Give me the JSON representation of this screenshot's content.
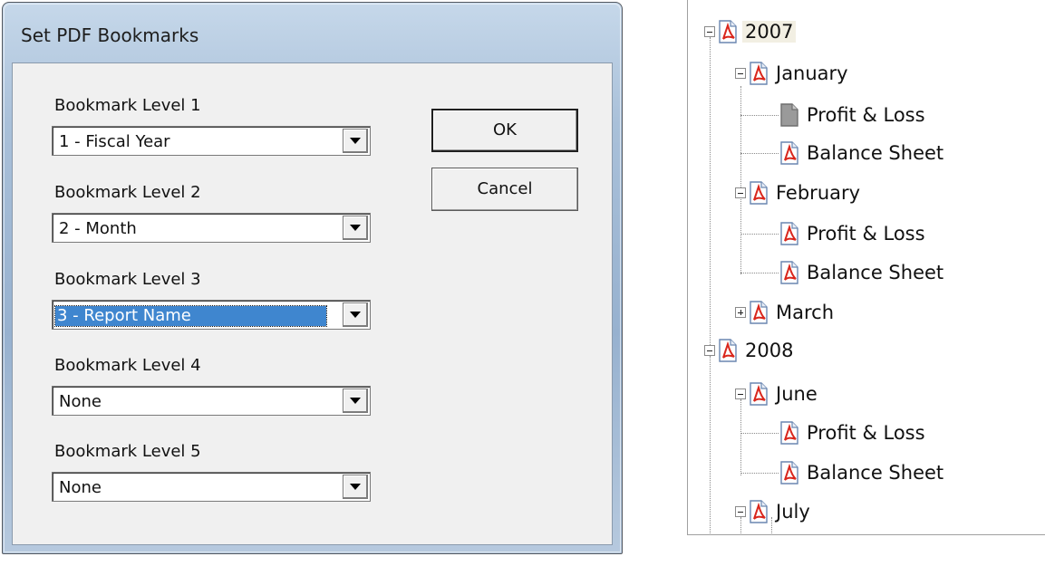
{
  "dialog": {
    "title": "Set PDF Bookmarks",
    "levels": [
      {
        "label": "Bookmark Level 1",
        "value": "1 - Fiscal Year"
      },
      {
        "label": "Bookmark Level 2",
        "value": "2 - Month"
      },
      {
        "label": "Bookmark Level 3",
        "value": "3 - Report Name"
      },
      {
        "label": "Bookmark Level 4",
        "value": "None"
      },
      {
        "label": "Bookmark Level 5",
        "value": "None"
      }
    ],
    "ok_label": "OK",
    "cancel_label": "Cancel"
  },
  "tree": {
    "nodes": [
      {
        "label": "2007",
        "icon": "pdf-icon",
        "expander": "minus"
      },
      {
        "label": "January",
        "icon": "pdf-icon",
        "expander": "minus"
      },
      {
        "label": "Profit & Loss",
        "icon": "document-gray-icon",
        "expander": "none"
      },
      {
        "label": "Balance Sheet",
        "icon": "pdf-icon",
        "expander": "none"
      },
      {
        "label": "February",
        "icon": "pdf-icon",
        "expander": "minus"
      },
      {
        "label": "Profit & Loss",
        "icon": "pdf-icon",
        "expander": "none"
      },
      {
        "label": "Balance Sheet",
        "icon": "pdf-icon",
        "expander": "none"
      },
      {
        "label": "March",
        "icon": "pdf-icon",
        "expander": "plus"
      },
      {
        "label": "2008",
        "icon": "pdf-icon",
        "expander": "minus"
      },
      {
        "label": "June",
        "icon": "pdf-icon",
        "expander": "minus"
      },
      {
        "label": "Profit & Loss",
        "icon": "pdf-icon",
        "expander": "none"
      },
      {
        "label": "Balance Sheet",
        "icon": "pdf-icon",
        "expander": "none"
      },
      {
        "label": "July",
        "icon": "pdf-icon",
        "expander": "minus"
      }
    ]
  },
  "colors": {
    "selection": "#3f86cf",
    "pdf_red": "#d9261c",
    "highlight": "#f2efe3"
  }
}
